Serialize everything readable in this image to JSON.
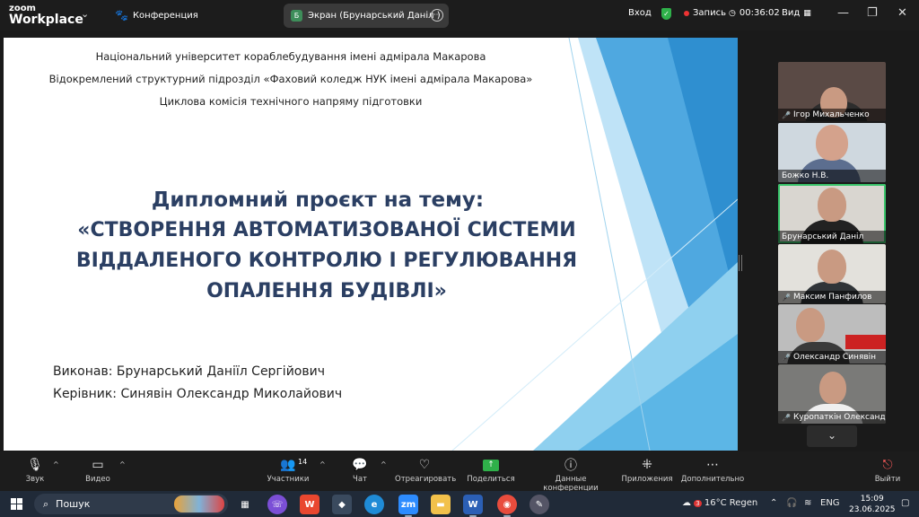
{
  "topbar": {
    "logo_line1": "zoom",
    "logo_line2": "Workplace",
    "conference_label": "Конференция",
    "tab_badge": "Б",
    "tab_label": "Экран (Брунарський Даніл )",
    "login_label": "Вход",
    "record_label": "Запись",
    "timer": "00:36:02",
    "view_label": "Вид"
  },
  "slide": {
    "header_lines": [
      "Національний університет кораблебудування імені адмірала Макарова",
      "Відокремлений структурний підрозділ «Фаховий коледж НУК імені адмірала Макарова»",
      "Циклова комісія технічного напряму підготовки"
    ],
    "title_line1": "Дипломний проєкт на тему:",
    "title_lines": [
      "«СТВОРЕННЯ АВТОМАТИЗОВАНОЇ СИСТЕМИ",
      "ВІДДАЛЕНОГО КОНТРОЛЮ І РЕГУЛЮВАННЯ",
      "ОПАЛЕННЯ БУДІВЛІ»"
    ],
    "author": "Виконав: Брунарський Даніїл Сергійович",
    "supervisor": "Керівник: Синявін Олександр Миколайович",
    "colors": {
      "title": "#2b3f63",
      "accent_blue": "#4fa8e0",
      "light_blue": "#bfe3f7"
    }
  },
  "participants": [
    {
      "name": "Ігор Михальченко",
      "muted": true,
      "active": false
    },
    {
      "name": "Божко Н.В.",
      "muted": false,
      "active": false
    },
    {
      "name": "Брунарський Даніл",
      "muted": false,
      "active": true
    },
    {
      "name": "Максим Панфилов",
      "muted": true,
      "active": false
    },
    {
      "name": "Олександр Синявін",
      "muted": true,
      "active": false
    },
    {
      "name": "Куропаткін Олександр",
      "muted": true,
      "active": false
    }
  ],
  "toolbar": {
    "audio": "Звук",
    "video": "Видео",
    "participants": "Участники",
    "participants_count": "14",
    "chat": "Чат",
    "react": "Отреагировать",
    "share": "Поделиться",
    "info": "Данные конференции",
    "apps": "Приложения",
    "more": "Дополнительно",
    "leave": "Выйти"
  },
  "taskbar": {
    "search_label": "Пошук",
    "weather": "16°C  Regen",
    "weather_badge": "3",
    "lang": "ENG",
    "time": "15:09",
    "date": "23.06.2025"
  }
}
